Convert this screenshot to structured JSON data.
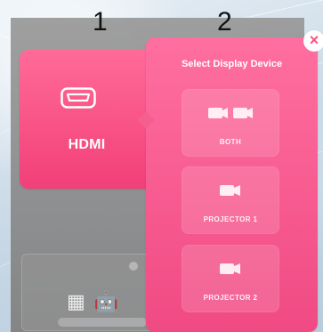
{
  "steps": {
    "first": "1",
    "second": "2"
  },
  "source": {
    "label": "HDMI",
    "icon": "hdmi-port-icon"
  },
  "device_selector": {
    "title": "Select Display Device",
    "close_icon": "close-icon",
    "options": [
      {
        "label": "BOTH",
        "icon": "double-camera-icon"
      },
      {
        "label": "PROJECTOR 1",
        "icon": "camera-icon"
      },
      {
        "label": "PROJECTOR 2",
        "icon": "camera-icon"
      }
    ]
  },
  "background_card": {
    "icons": [
      "windows-icon",
      "android-icon"
    ]
  },
  "colors": {
    "accent": "#f04a83",
    "accent_light": "#ff6fa0",
    "close_glyph": "#ff4e84"
  }
}
